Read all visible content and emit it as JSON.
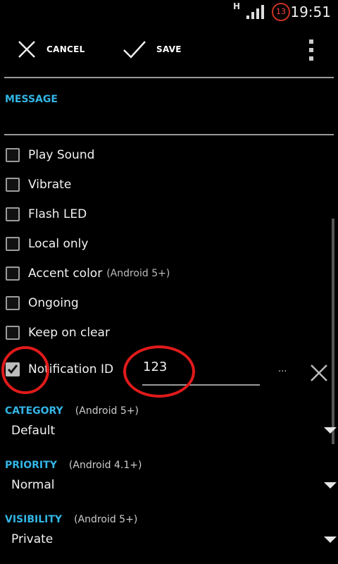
{
  "statusbar": {
    "network_type": "H",
    "notification_count": "13",
    "time": "19:51"
  },
  "actionbar": {
    "cancel_label": "CANCEL",
    "save_label": "SAVE"
  },
  "message": {
    "header": "MESSAGE",
    "value": ""
  },
  "checkboxes": [
    {
      "label": "Play Sound",
      "note": "",
      "checked": false
    },
    {
      "label": "Vibrate",
      "note": "",
      "checked": false
    },
    {
      "label": "Flash LED",
      "note": "",
      "checked": false
    },
    {
      "label": "Local only",
      "note": "",
      "checked": false
    },
    {
      "label": "Accent color",
      "note": "(Android 5+)",
      "checked": false
    },
    {
      "label": "Ongoing",
      "note": "",
      "checked": false
    },
    {
      "label": "Keep on clear",
      "note": "",
      "checked": false
    }
  ],
  "notification_id": {
    "label": "Notification ID",
    "checked": true,
    "value": "123",
    "more_label": "..."
  },
  "category": {
    "header": "CATEGORY",
    "note": "(Android 5+)",
    "value": "Default"
  },
  "priority": {
    "header": "PRIORITY",
    "note": "(Android 4.1+)",
    "value": "Normal"
  },
  "visibility": {
    "header": "VISIBILITY",
    "note": "(Android 5+)",
    "value": "Private"
  },
  "colors": {
    "accent": "#33b5e5",
    "annotation": "#e01a1a",
    "background": "#000000"
  }
}
